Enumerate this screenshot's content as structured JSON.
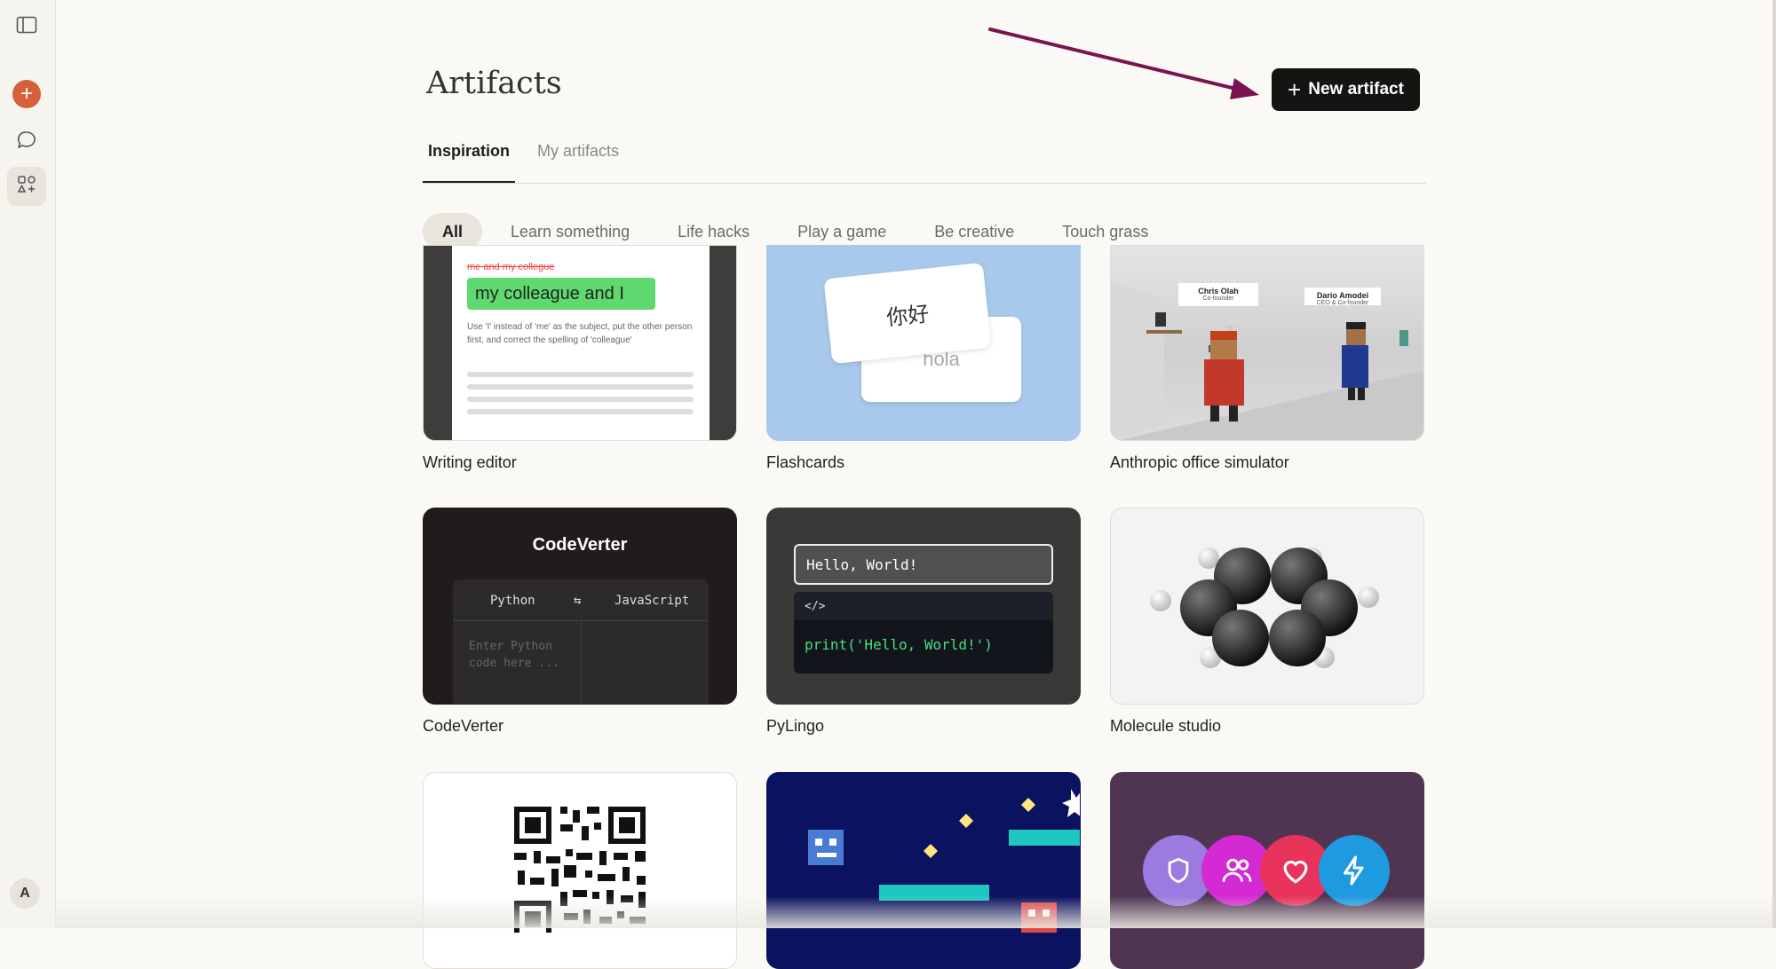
{
  "header": {
    "title": "Artifacts",
    "new_button": "New artifact"
  },
  "tabs": [
    {
      "label": "Inspiration",
      "active": true
    },
    {
      "label": "My artifacts",
      "active": false
    }
  ],
  "filters": [
    {
      "label": "All",
      "active": true
    },
    {
      "label": "Learn something",
      "active": false
    },
    {
      "label": "Life hacks",
      "active": false
    },
    {
      "label": "Play a game",
      "active": false
    },
    {
      "label": "Be creative",
      "active": false
    },
    {
      "label": "Touch grass",
      "active": false
    }
  ],
  "user": {
    "avatar_letter": "A"
  },
  "cards": [
    {
      "title": "Writing editor",
      "preview": {
        "struck": "me and my collegue",
        "corrected": "my colleague and I",
        "note": "Use 'I' instead of 'me' as the subject, put the other person first, and correct the spelling of 'colleague'"
      }
    },
    {
      "title": "Flashcards",
      "preview": {
        "front": "你好",
        "back": "hola"
      }
    },
    {
      "title": "Anthropic office simulator",
      "preview": {
        "sign1_name": "Chris Olah",
        "sign1_role": "Co-founder",
        "sign2_name": "Dario Amodei",
        "sign2_role": "CEO & Co-founder"
      }
    },
    {
      "title": "CodeVerter",
      "preview": {
        "heading": "CodeVerter",
        "from": "Python",
        "swap": "⇆",
        "to": "JavaScript",
        "placeholder": "Enter Python code here ..."
      }
    },
    {
      "title": "PyLingo",
      "preview": {
        "input": "Hello, World!",
        "code_tag": "</>",
        "code": "print('Hello, World!')"
      }
    },
    {
      "title": "Molecule studio"
    },
    {
      "title": ""
    },
    {
      "title": ""
    },
    {
      "title": ""
    }
  ],
  "colors": {
    "background": "#faf9f5",
    "brand_orange": "#d4613c",
    "button_dark": "#141413",
    "annotation_arrow": "#7a1450"
  },
  "icons": {
    "sidebar_toggle": "sidebar-toggle-icon",
    "new_chat": "plus-icon",
    "chats": "chat-bubble-icon",
    "artifacts": "artifacts-icon"
  }
}
